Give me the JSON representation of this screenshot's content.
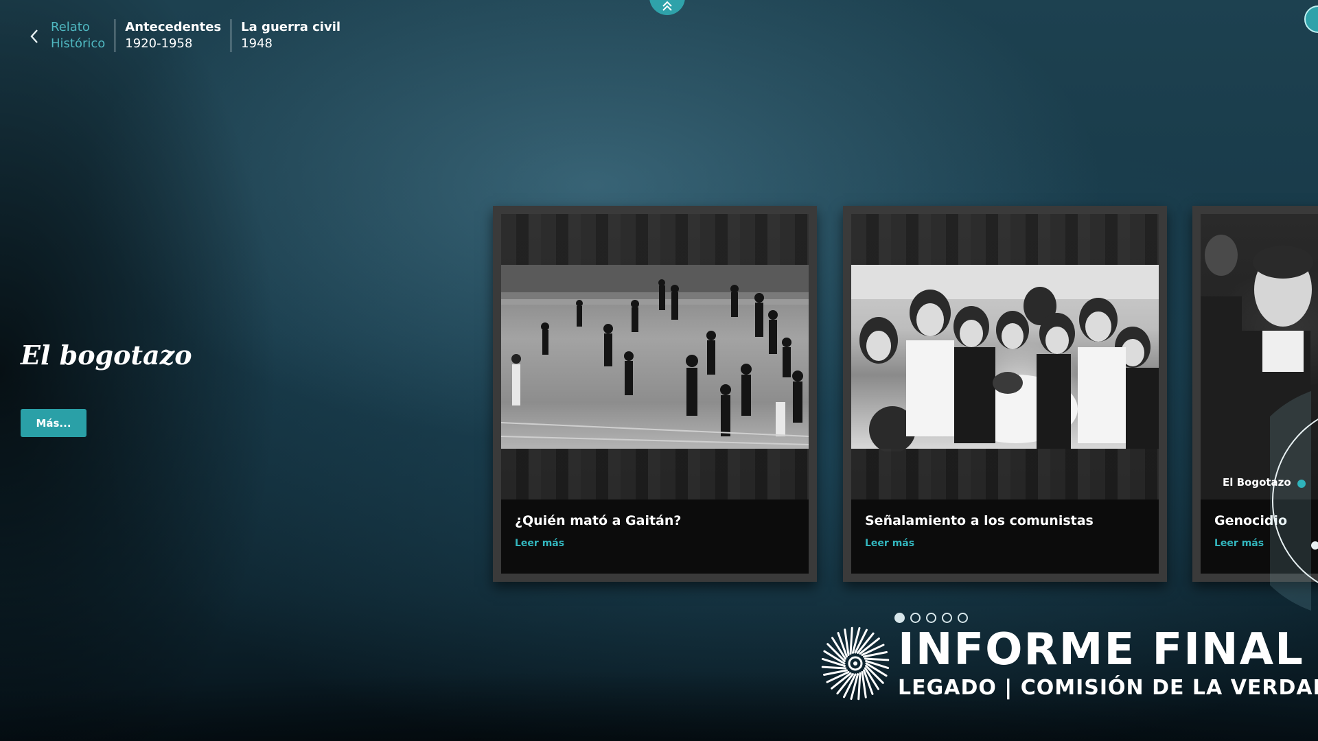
{
  "breadcrumb": {
    "items": [
      {
        "title": "Relato",
        "subtitle": "Histórico"
      },
      {
        "title": "Antecedentes",
        "subtitle": "1920-1958"
      },
      {
        "title": "La guerra civil",
        "subtitle": "1948"
      }
    ]
  },
  "section": {
    "title": "El bogotazo",
    "more_label": "Más..."
  },
  "cards": [
    {
      "title": "¿Quién mató a Gaitán?",
      "link": "Leer más"
    },
    {
      "title": "Señalamiento a los comunistas",
      "link": "Leer más"
    },
    {
      "title": "Genocidio",
      "link": "Leer más"
    }
  ],
  "timeline": {
    "current_label": "El Bogotazo"
  },
  "pager": {
    "count": 5,
    "active_index": 0
  },
  "logo": {
    "main": "INFORME FINAL",
    "left": "LEGADO",
    "right": "COMISIÓN DE LA VERDAD"
  },
  "colors": {
    "accent": "#2aa0a7",
    "link": "#33b7bf"
  }
}
